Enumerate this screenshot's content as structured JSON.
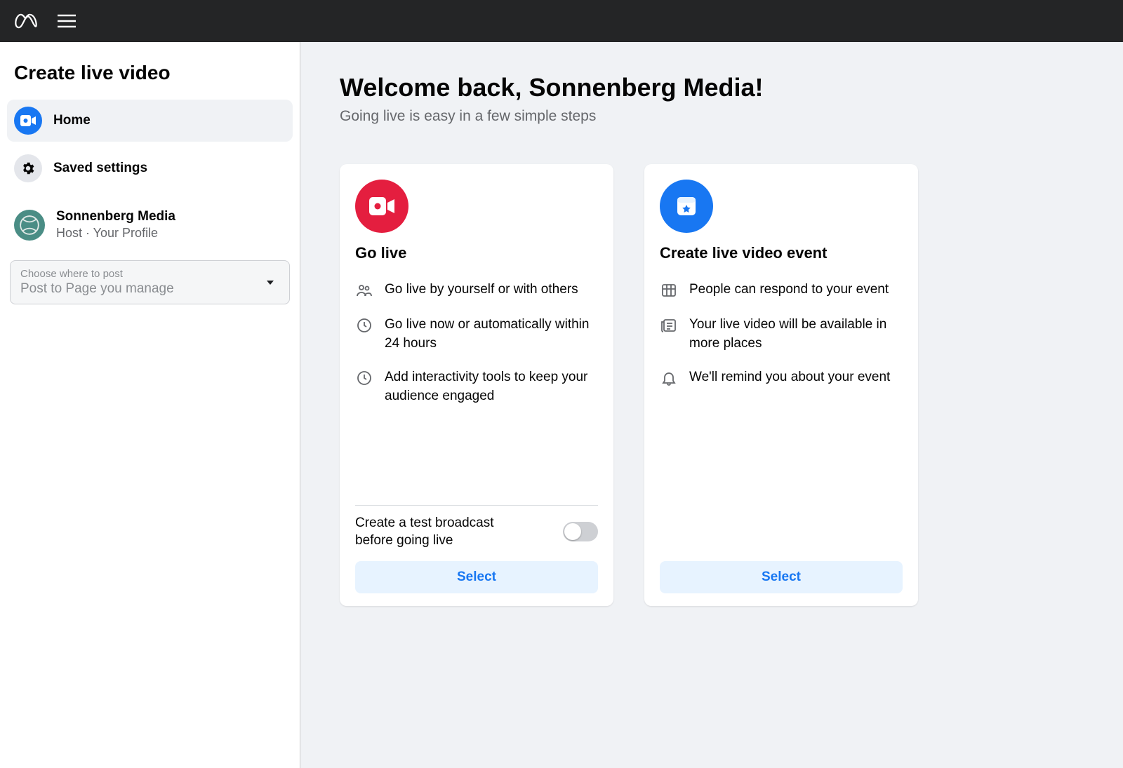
{
  "sidebar": {
    "title": "Create live video",
    "items": [
      {
        "label": "Home",
        "active": true
      },
      {
        "label": "Saved settings",
        "active": false
      }
    ],
    "profile": {
      "name": "Sonnenberg Media",
      "role": "Host · Your Profile"
    },
    "post_selector": {
      "label": "Choose where to post",
      "value": "Post to Page you manage"
    }
  },
  "main": {
    "welcome": "Welcome back, Sonnenberg Media!",
    "subtitle": "Going live is easy in a few simple steps",
    "cards": [
      {
        "title": "Go live",
        "icon": "camera-icon",
        "color": "red",
        "features": [
          {
            "icon": "people-icon",
            "text": "Go live by yourself or with others"
          },
          {
            "icon": "clock-icon",
            "text": "Go live now or automatically within 24 hours"
          },
          {
            "icon": "clock-icon",
            "text": "Add interactivity tools to keep your audience engaged"
          }
        ],
        "toggle": {
          "label": "Create a test broadcast before going live",
          "on": false
        },
        "cta": "Select"
      },
      {
        "title": "Create live video event",
        "icon": "calendar-icon",
        "color": "blue",
        "features": [
          {
            "icon": "grid-icon",
            "text": "People can respond to your event"
          },
          {
            "icon": "news-icon",
            "text": "Your live video will be available in more places"
          },
          {
            "icon": "bell-icon",
            "text": "We'll remind you about your event"
          }
        ],
        "cta": "Select"
      }
    ]
  }
}
